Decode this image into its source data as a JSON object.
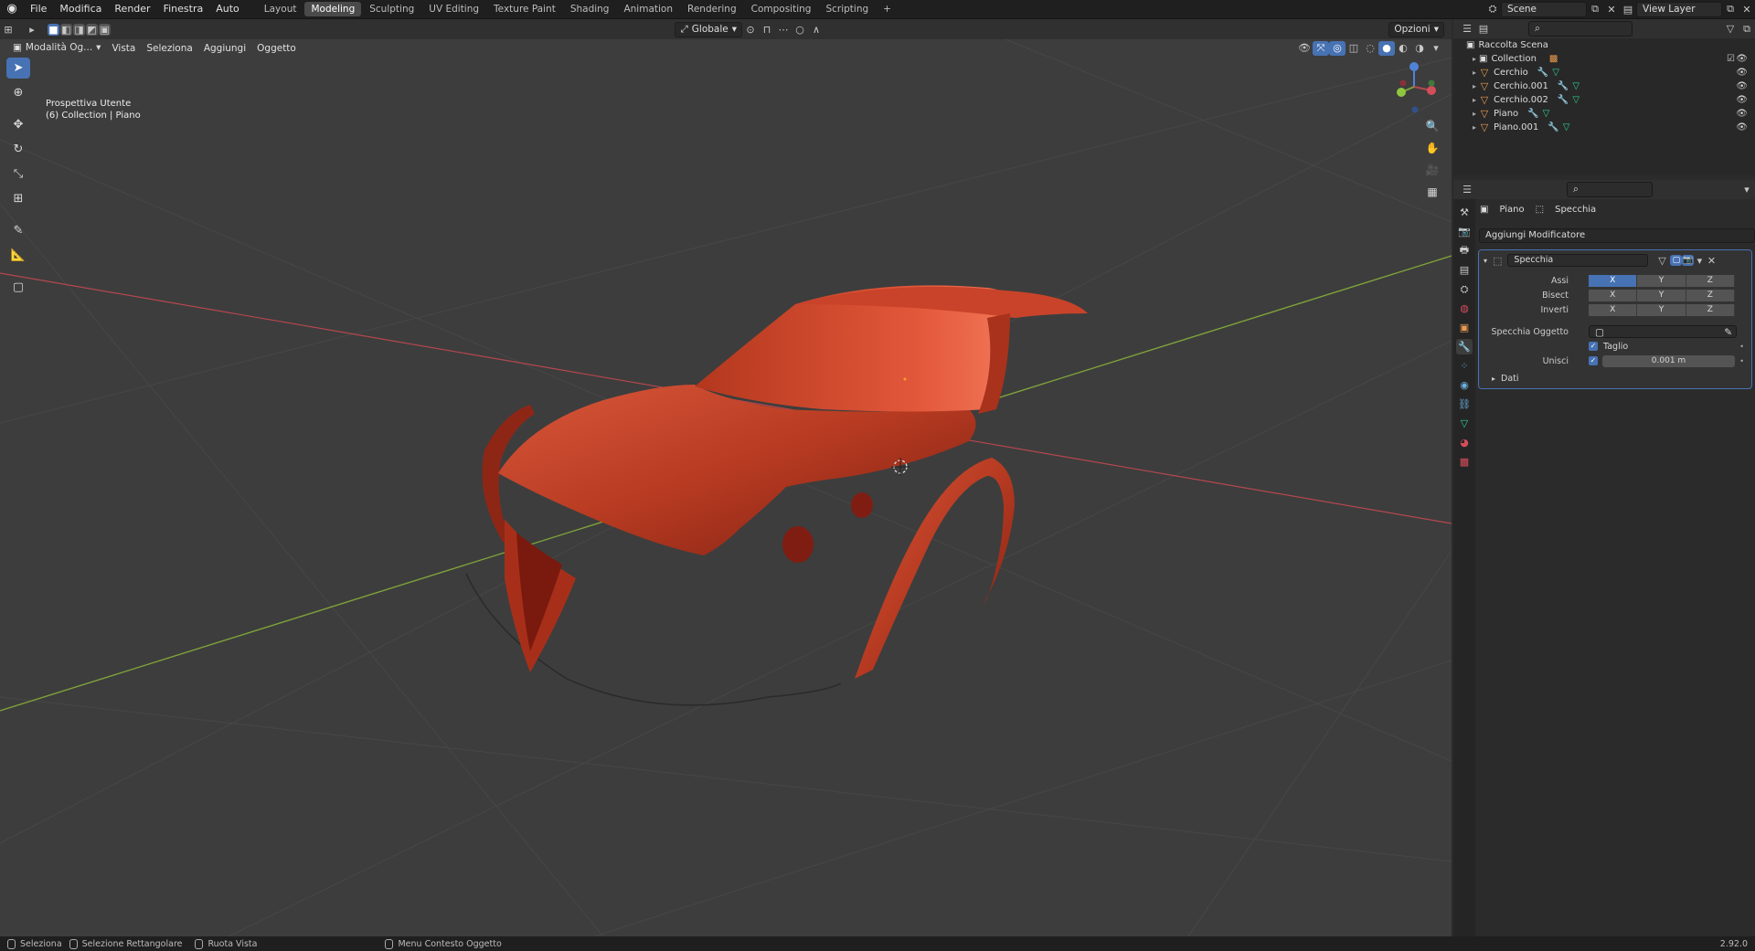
{
  "topbar": {
    "menus": [
      "File",
      "Modifica",
      "Render",
      "Finestra",
      "Auto"
    ],
    "workspaces": [
      "Layout",
      "Modeling",
      "Sculpting",
      "UV Editing",
      "Texture Paint",
      "Shading",
      "Animation",
      "Rendering",
      "Compositing",
      "Scripting"
    ],
    "active_workspace": "Modeling",
    "add_workspace": "+",
    "scene": "Scene",
    "view_layer": "View Layer"
  },
  "viewport_header": {
    "mode": "Modalità Og...",
    "menus": [
      "Vista",
      "Seleziona",
      "Aggiungi",
      "Oggetto"
    ],
    "orientation": "Globale",
    "options": "Opzioni"
  },
  "viewport": {
    "view_name": "Prospettiva Utente",
    "collection_info": "(6) Collection | Piano",
    "object_color": "#c23a22",
    "background": "#3d3d3d"
  },
  "outliner": {
    "root": "Raccolta Scena",
    "items": [
      {
        "name": "Collection",
        "type": "collection"
      },
      {
        "name": "Cerchio",
        "type": "object"
      },
      {
        "name": "Cerchio.001",
        "type": "object"
      },
      {
        "name": "Cerchio.002",
        "type": "object"
      },
      {
        "name": "Piano",
        "type": "object"
      },
      {
        "name": "Piano.001",
        "type": "object"
      }
    ]
  },
  "properties": {
    "object": "Piano",
    "modifier_crumb": "Specchia",
    "add_modifier": "Aggiungi Modificatore",
    "modifier": {
      "name": "Specchia",
      "assi_label": "Assi",
      "bisect_label": "Bisect",
      "inverti_label": "Inverti",
      "axes": [
        "X",
        "Y",
        "Z"
      ],
      "assi_active": "X",
      "specchia_oggetto_label": "Specchia Oggetto",
      "taglio_label": "Taglio",
      "unisci_label": "Unisci",
      "unisci_value": "0.001 m",
      "dati_label": "Dati"
    }
  },
  "statusbar": {
    "items": [
      "Seleziona",
      "Selezione Rettangolare",
      "Ruota Vista",
      "Menu Contesto Oggetto"
    ],
    "version": "2.92.0"
  },
  "colors": {
    "accent": "#4772b3",
    "x_axis": "#b5474f",
    "y_axis": "#7ea23a",
    "object_red": "#c23a22"
  }
}
